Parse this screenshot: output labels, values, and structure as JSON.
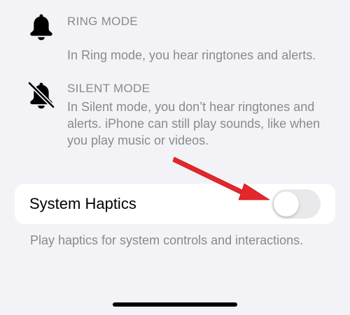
{
  "modes": [
    {
      "icon": "bell-icon",
      "title": "RING MODE",
      "description": "In Ring mode, you hear ringtones and alerts."
    },
    {
      "icon": "bell-slash-icon",
      "title": "SILENT MODE",
      "description": "In Silent mode, you don’t hear ringtones and alerts. iPhone can still play sounds, like when you play music or videos."
    }
  ],
  "setting": {
    "label": "System Haptics",
    "toggle_on": false,
    "footer": "Play haptics for system controls and interactions."
  },
  "annotation": {
    "icon": "arrow-icon",
    "color": "#e5262b"
  },
  "colors": {
    "background": "#f2f2f7",
    "secondary_text": "#8a8a8e",
    "toggle_off": "#e9e9eb"
  }
}
